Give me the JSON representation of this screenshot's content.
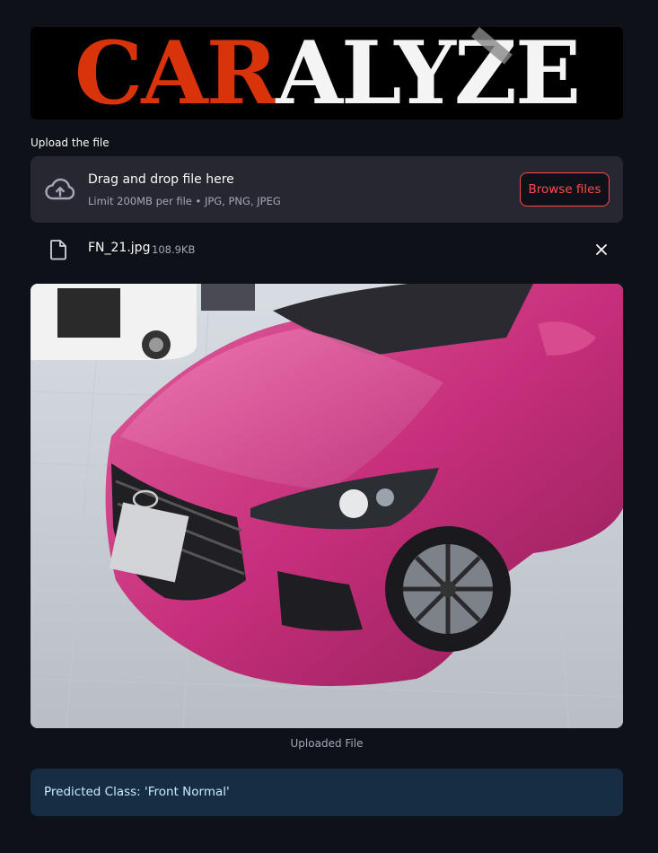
{
  "logo": {
    "part1": "CAR",
    "part2": "ALYZE",
    "colors": {
      "part1": "#d8330b",
      "part2": "#f4f4f4",
      "background": "#000000"
    }
  },
  "uploader": {
    "label": "Upload the file",
    "dropzone_title": "Drag and drop file here",
    "dropzone_subtitle": "Limit 200MB per file • JPG, PNG, JPEG",
    "browse_label": "Browse files",
    "icon": "cloud-upload-icon"
  },
  "file": {
    "name": "FN_21.jpg",
    "size": "108.9KB",
    "icon": "file-icon",
    "remove_icon": "close-icon"
  },
  "image": {
    "caption": "Uploaded File",
    "alt": "Uploaded File"
  },
  "result": {
    "text": "Predicted Class: 'Front Normal'"
  },
  "colors": {
    "background": "#0e1117",
    "accent": "#ff4b4b",
    "panel": "#262730",
    "info_bg": "#172d43",
    "info_text": "#c7ebff"
  }
}
